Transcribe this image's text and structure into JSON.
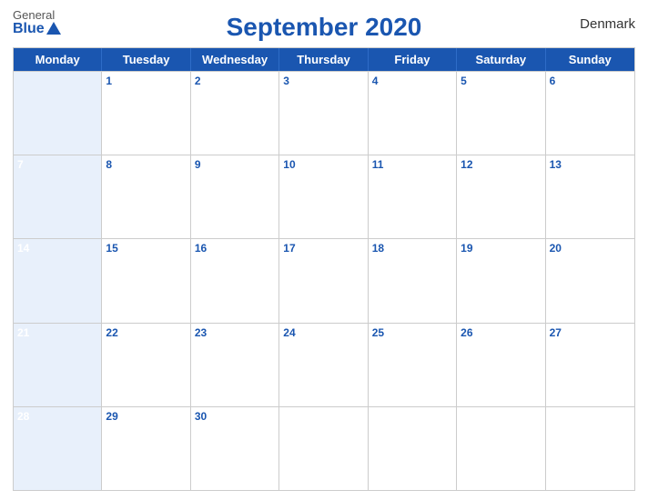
{
  "header": {
    "logo_general": "General",
    "logo_blue": "Blue",
    "title": "September 2020",
    "country": "Denmark"
  },
  "days_of_week": [
    "Monday",
    "Tuesday",
    "Wednesday",
    "Thursday",
    "Friday",
    "Saturday",
    "Sunday"
  ],
  "weeks": [
    {
      "days": [
        {
          "num": "",
          "empty": true
        },
        {
          "num": "1",
          "empty": false
        },
        {
          "num": "2",
          "empty": false
        },
        {
          "num": "3",
          "empty": false
        },
        {
          "num": "4",
          "empty": false
        },
        {
          "num": "5",
          "empty": false
        },
        {
          "num": "6",
          "empty": false
        }
      ]
    },
    {
      "days": [
        {
          "num": "7",
          "empty": false
        },
        {
          "num": "8",
          "empty": false
        },
        {
          "num": "9",
          "empty": false
        },
        {
          "num": "10",
          "empty": false
        },
        {
          "num": "11",
          "empty": false
        },
        {
          "num": "12",
          "empty": false
        },
        {
          "num": "13",
          "empty": false
        }
      ]
    },
    {
      "days": [
        {
          "num": "14",
          "empty": false
        },
        {
          "num": "15",
          "empty": false
        },
        {
          "num": "16",
          "empty": false
        },
        {
          "num": "17",
          "empty": false
        },
        {
          "num": "18",
          "empty": false
        },
        {
          "num": "19",
          "empty": false
        },
        {
          "num": "20",
          "empty": false
        }
      ]
    },
    {
      "days": [
        {
          "num": "21",
          "empty": false
        },
        {
          "num": "22",
          "empty": false
        },
        {
          "num": "23",
          "empty": false
        },
        {
          "num": "24",
          "empty": false
        },
        {
          "num": "25",
          "empty": false
        },
        {
          "num": "26",
          "empty": false
        },
        {
          "num": "27",
          "empty": false
        }
      ]
    },
    {
      "days": [
        {
          "num": "28",
          "empty": false
        },
        {
          "num": "29",
          "empty": false
        },
        {
          "num": "30",
          "empty": false
        },
        {
          "num": "",
          "empty": true
        },
        {
          "num": "",
          "empty": true
        },
        {
          "num": "",
          "empty": true
        },
        {
          "num": "",
          "empty": true
        }
      ]
    }
  ],
  "colors": {
    "blue": "#1a56b0",
    "white": "#ffffff",
    "light_bg": "#f5f5f5"
  }
}
